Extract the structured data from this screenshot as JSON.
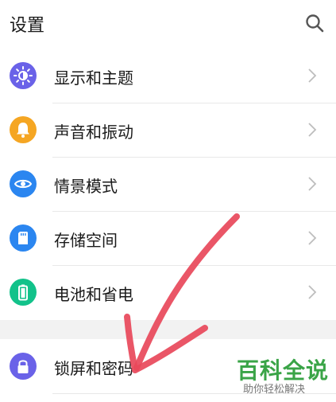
{
  "header": {
    "title": "设置",
    "search_icon": "search-icon"
  },
  "items": [
    {
      "label": "显示和主题",
      "icon": "brightness-icon",
      "color": "#6a62e8"
    },
    {
      "label": "声音和振动",
      "icon": "bell-icon",
      "color": "#f5a623"
    },
    {
      "label": "情景模式",
      "icon": "eye-icon",
      "color": "#2b86f0"
    },
    {
      "label": "存储空间",
      "icon": "sd-card-icon",
      "color": "#2b86f0"
    },
    {
      "label": "电池和省电",
      "icon": "battery-icon",
      "color": "#12c28a"
    },
    {
      "label": "锁屏和密码",
      "icon": "lock-icon",
      "color": "#6a62e8"
    }
  ],
  "watermark": {
    "title": "百科全说",
    "subtitle": "助你轻松解决",
    "color": "#3aa447"
  },
  "annotation": {
    "arrow_color": "#e8485a"
  }
}
